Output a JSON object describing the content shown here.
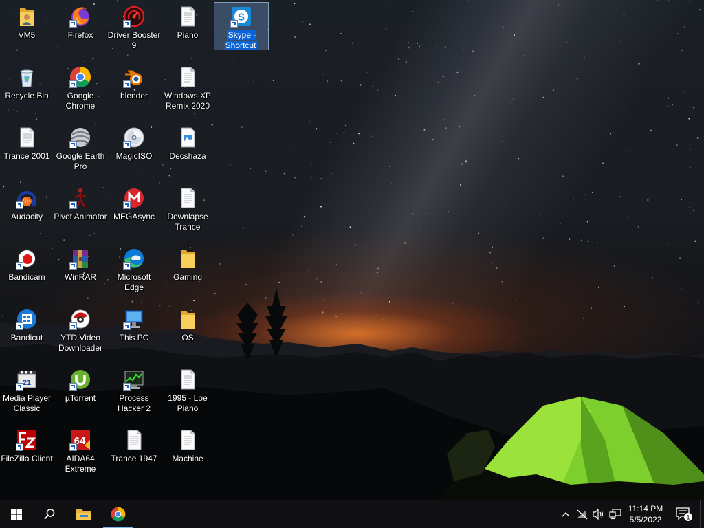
{
  "desktop": {
    "icons": [
      {
        "label": "VM5",
        "icon": "folder-user-icon",
        "shortcut": false
      },
      {
        "label": "Firefox",
        "icon": "firefox-icon",
        "shortcut": true
      },
      {
        "label": "Driver Booster 9",
        "icon": "driver-booster-icon",
        "shortcut": true
      },
      {
        "label": "Piano",
        "icon": "document-icon",
        "shortcut": false
      },
      {
        "label": "Skype - Shortcut",
        "icon": "skype-icon",
        "shortcut": true,
        "selected": true
      },
      {
        "label": "Recycle Bin",
        "icon": "recycle-bin-icon",
        "shortcut": false
      },
      {
        "label": "Google Chrome",
        "icon": "chrome-icon",
        "shortcut": true
      },
      {
        "label": "blender",
        "icon": "blender-icon",
        "shortcut": true
      },
      {
        "label": "Windows XP Remix 2020",
        "icon": "document-icon",
        "shortcut": false
      },
      {
        "label": "Trance 2001",
        "icon": "document-icon",
        "shortcut": false
      },
      {
        "label": "Google Earth Pro",
        "icon": "google-earth-icon",
        "shortcut": true
      },
      {
        "label": "MagicISO",
        "icon": "disc-icon",
        "shortcut": true
      },
      {
        "label": "Decshaza",
        "icon": "image-file-icon",
        "shortcut": false
      },
      {
        "label": "Audacity",
        "icon": "audacity-icon",
        "shortcut": true
      },
      {
        "label": "Pivot Animator",
        "icon": "pivot-animator-icon",
        "shortcut": true
      },
      {
        "label": "MEGAsync",
        "icon": "mega-icon",
        "shortcut": true
      },
      {
        "label": "Downlapse Trance",
        "icon": "document-icon",
        "shortcut": false
      },
      {
        "label": "Bandicam",
        "icon": "bandicam-icon",
        "shortcut": true
      },
      {
        "label": "WinRAR",
        "icon": "winrar-icon",
        "shortcut": true
      },
      {
        "label": "Microsoft Edge",
        "icon": "edge-icon",
        "shortcut": true
      },
      {
        "label": "Gaming",
        "icon": "folder-icon",
        "shortcut": false
      },
      {
        "label": "Bandicut",
        "icon": "bandicut-icon",
        "shortcut": true
      },
      {
        "label": "YTD Video Downloader",
        "icon": "ytd-icon",
        "shortcut": true
      },
      {
        "label": "This PC",
        "icon": "this-pc-icon",
        "shortcut": true
      },
      {
        "label": "OS",
        "icon": "folder-icon",
        "shortcut": false
      },
      {
        "label": "Media Player Classic",
        "icon": "mpc-icon",
        "shortcut": true
      },
      {
        "label": "µTorrent",
        "icon": "utorrent-icon",
        "shortcut": true
      },
      {
        "label": "Process Hacker 2",
        "icon": "process-hacker-icon",
        "shortcut": true
      },
      {
        "label": "1995 - Loe Piano",
        "icon": "document-icon",
        "shortcut": false
      },
      {
        "label": "FileZilla Client",
        "icon": "filezilla-icon",
        "shortcut": true
      },
      {
        "label": "AIDA64 Extreme",
        "icon": "aida64-icon",
        "shortcut": true
      },
      {
        "label": "Trance 1947",
        "icon": "document-icon",
        "shortcut": false
      },
      {
        "label": "Machine",
        "icon": "document-icon",
        "shortcut": false
      }
    ]
  },
  "taskbar": {
    "start_icon": "windows-logo-icon",
    "search_icon": "search-icon",
    "pinned": [
      {
        "name": "file-explorer",
        "icon": "file-explorer-icon",
        "active": false
      },
      {
        "name": "chrome",
        "icon": "chrome-icon",
        "active": true
      }
    ],
    "tray": {
      "icons": [
        "chevron-up-icon",
        "network-disconnected-icon",
        "volume-icon",
        "display-icon"
      ],
      "time": "11:14 PM",
      "date": "5/5/2022",
      "notification_count": "1"
    }
  },
  "colors": {
    "selection": "#0a64d8",
    "taskbar": "#101012",
    "accent": "#7fb2e8"
  }
}
